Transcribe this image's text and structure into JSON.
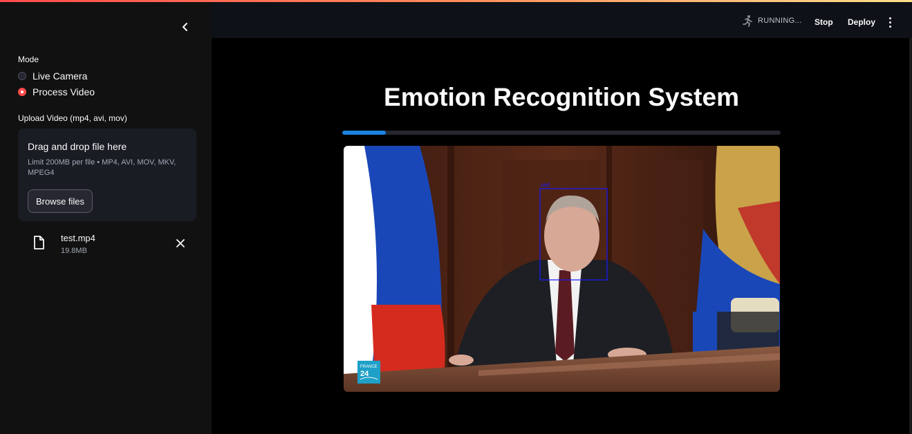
{
  "sidebar": {
    "mode_label": "Mode",
    "mode_options": [
      {
        "label": "Live Camera",
        "selected": false
      },
      {
        "label": "Process Video",
        "selected": true
      }
    ],
    "upload_label": "Upload Video (mp4, avi, mov)",
    "dropzone": {
      "title": "Drag and drop file here",
      "limit": "Limit 200MB per file • MP4, AVI, MOV, MKV, MPEG4",
      "browse_label": "Browse files"
    },
    "uploaded_file": {
      "name": "test.mp4",
      "size": "19.8MB"
    }
  },
  "header": {
    "status": "RUNNING...",
    "stop_label": "Stop",
    "deploy_label": "Deploy"
  },
  "main": {
    "title": "Emotion Recognition System",
    "progress_fraction": 0.1,
    "video": {
      "detection_label": "sad",
      "watermark_lines": [
        "FRANCE",
        "24"
      ]
    }
  },
  "colors": {
    "accent": "#ff4b4b",
    "progress": "#1c83e1",
    "sidebar_bg": "#111111",
    "header_bg": "#0e1117",
    "bbox": "#1a1aff"
  },
  "icons": [
    "chevron-left-icon",
    "running-person-icon",
    "kebab-menu-icon",
    "file-icon",
    "close-icon"
  ]
}
